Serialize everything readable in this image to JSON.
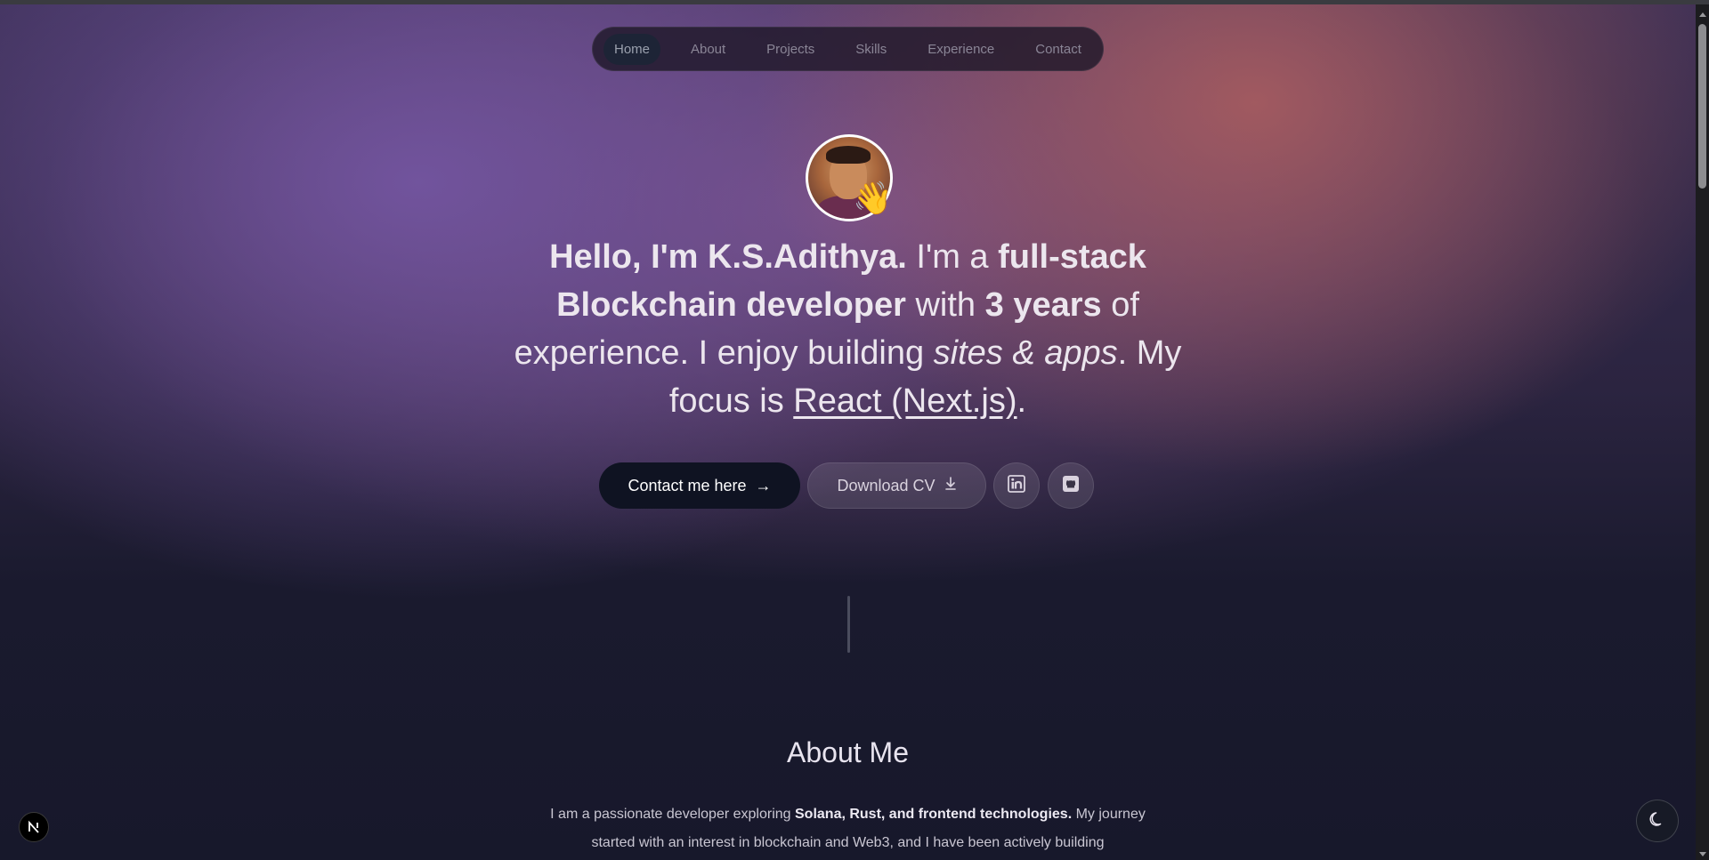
{
  "nav": {
    "items": [
      {
        "label": "Home"
      },
      {
        "label": "About"
      },
      {
        "label": "Projects"
      },
      {
        "label": "Skills"
      },
      {
        "label": "Experience"
      },
      {
        "label": "Contact"
      }
    ],
    "active": "Home"
  },
  "hero": {
    "greeting": "Hello, I'm K.S.Adithya.",
    "im_a": " I'm a ",
    "role": "full-stack Blockchain developer",
    "with": " with ",
    "years": "3 years",
    "of_experience": " of experience. I enjoy building ",
    "sites_apps": "sites & apps",
    "my_focus": ". My focus is ",
    "focus": "React (Next.js)",
    "period": "."
  },
  "buttons": {
    "contact": "Contact me here",
    "contact_icon": "→",
    "download": "Download CV",
    "linkedin_icon": "linkedin-icon",
    "github_icon": "github-icon"
  },
  "about": {
    "title": "About Me",
    "text_1": "I am a passionate developer exploring ",
    "text_bold": "Solana, Rust, and frontend technologies.",
    "text_2": " My journey started with an interest in blockchain and Web3, and I have been actively building"
  },
  "badges": {
    "next_letter": "N",
    "theme_icon": "moon-icon"
  },
  "colors": {
    "background": "#17182b",
    "gradient_purple": "#7355a0",
    "gradient_rose": "#af5f5f",
    "button_dark": "#0f1322"
  }
}
